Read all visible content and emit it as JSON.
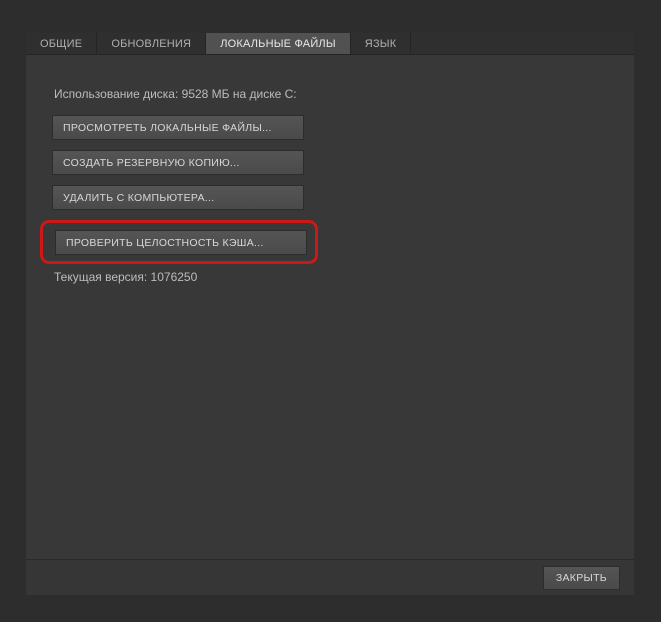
{
  "tabs": {
    "general": {
      "label": "ОБЩИЕ"
    },
    "updates": {
      "label": "ОБНОВЛЕНИЯ"
    },
    "localfiles": {
      "label": "ЛОКАЛЬНЫЕ ФАЙЛЫ"
    },
    "language": {
      "label": "ЯЗЫК"
    }
  },
  "disk_usage": "Использование диска: 9528 МБ на диске C:",
  "buttons": {
    "browse": "ПРОСМОТРЕТЬ ЛОКАЛЬНЫЕ ФАЙЛЫ...",
    "backup": "СОЗДАТЬ РЕЗЕРВНУЮ КОПИЮ...",
    "delete": "УДАЛИТЬ С КОМПЬЮТЕРА...",
    "verify": "ПРОВЕРИТЬ ЦЕЛОСТНОСТЬ КЭША..."
  },
  "version_line": "Текущая версия: 1076250",
  "footer": {
    "close": "ЗАКРЫТЬ"
  }
}
